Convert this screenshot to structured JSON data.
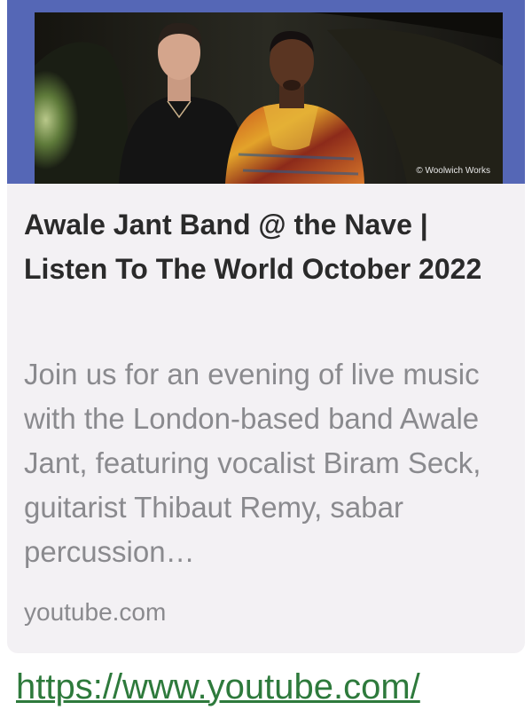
{
  "link_preview": {
    "image_alt": "Two musicians standing in a tunnel",
    "photo_credit": "© Woolwich Works",
    "title": "Awale Jant Band @ the Nave | Listen To The World October 2022",
    "description": "Join us for an evening of live music with the London-based band Awale Jant, featuring vocalist Biram Seck, guitarist Thibaut Remy, sabar percussion…",
    "domain": "youtube.com",
    "accent_color": "#5567b6"
  },
  "message": {
    "url_text": "https://www.youtube.com/"
  }
}
